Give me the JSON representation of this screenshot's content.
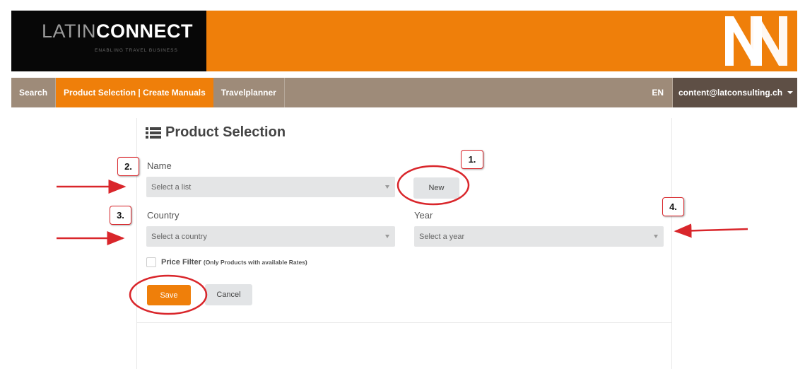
{
  "header": {
    "logo": {
      "prefix": "LATIN",
      "suffix": "CONNECT",
      "tagline": "ENABLING TRAVEL BUSINESS"
    },
    "brand_mark_icon": "nn-logo-icon",
    "colors": {
      "accent": "#ef7f0a",
      "nav": "#9e8b79",
      "user_menu": "#5e4f45"
    }
  },
  "nav": {
    "items": [
      {
        "label": "Search"
      },
      {
        "label": "Product Selection | Create Manuals",
        "active": true
      },
      {
        "label": "Travelplanner"
      }
    ],
    "language": "EN",
    "user_email": "content@latconsulting.ch"
  },
  "main": {
    "title": "Product Selection",
    "title_icon": "list-icon",
    "name_label": "Name",
    "name_select": {
      "placeholder": "Select a list"
    },
    "new_button": "New",
    "country_label": "Country",
    "country_select": {
      "placeholder": "Select a country"
    },
    "year_label": "Year",
    "year_select": {
      "placeholder": "Select a year"
    },
    "price_filter": {
      "label": "Price Filter",
      "note": "(Only Products with available Rates)",
      "checked": false
    },
    "save_button": "Save",
    "cancel_button": "Cancel"
  },
  "annotations": {
    "callouts": [
      "1.",
      "2.",
      "3.",
      "4."
    ],
    "color": "#d9262b"
  }
}
